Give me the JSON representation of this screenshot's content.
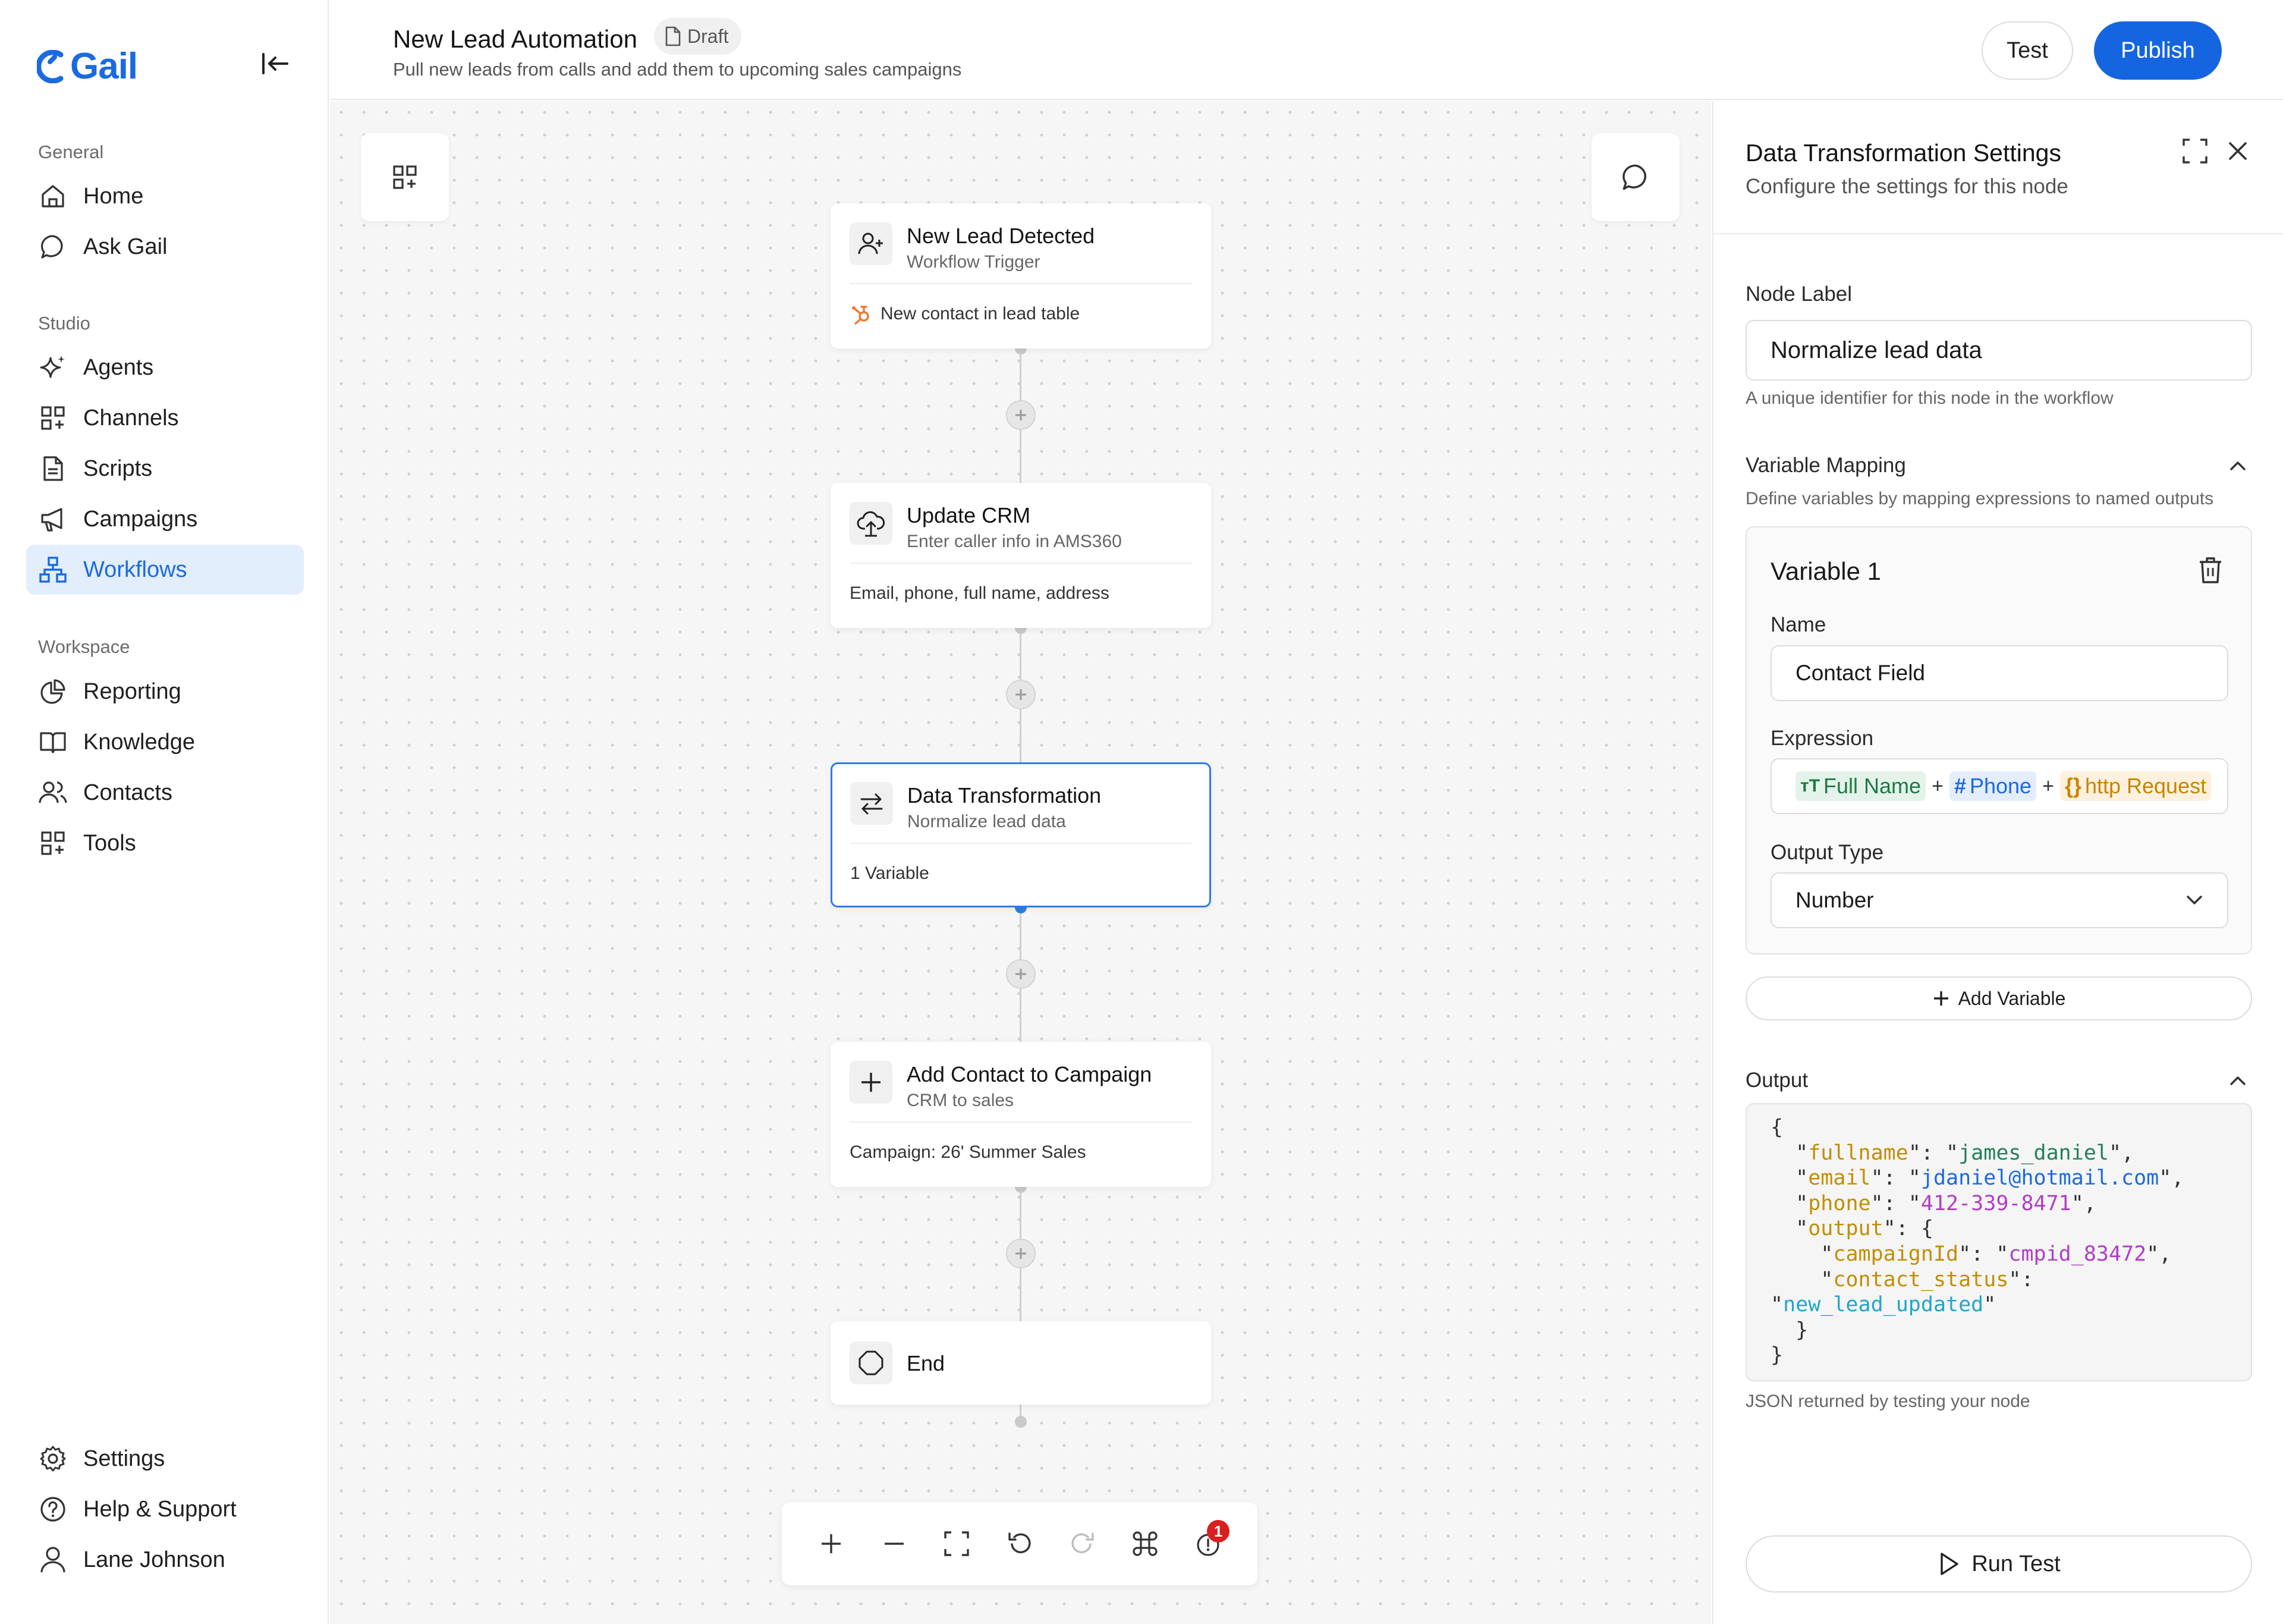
{
  "app": {
    "logo_text": "Gail",
    "brand_color": "#1b6ae0"
  },
  "sidebar": {
    "sections": [
      {
        "label": "General"
      },
      {
        "label": "Studio"
      },
      {
        "label": "Workspace"
      }
    ],
    "items": [
      {
        "label": "Home",
        "icon": "home-icon"
      },
      {
        "label": "Ask Gail",
        "icon": "chat-bubble-icon"
      },
      {
        "label": "Agents",
        "icon": "sparkle-icon"
      },
      {
        "label": "Channels",
        "icon": "grid-plus-icon"
      },
      {
        "label": "Scripts",
        "icon": "document-icon"
      },
      {
        "label": "Campaigns",
        "icon": "megaphone-icon"
      },
      {
        "label": "Workflows",
        "icon": "workflow-icon",
        "active": true
      },
      {
        "label": "Reporting",
        "icon": "pie-chart-icon"
      },
      {
        "label": "Knowledge",
        "icon": "book-icon"
      },
      {
        "label": "Contacts",
        "icon": "users-icon"
      },
      {
        "label": "Tools",
        "icon": "grid-plus-icon"
      }
    ],
    "bottom_items": [
      {
        "label": "Settings",
        "icon": "gear-icon"
      },
      {
        "label": "Help & Support",
        "icon": "help-circle-icon"
      },
      {
        "label": "Lane Johnson",
        "icon": "user-icon"
      }
    ]
  },
  "header": {
    "title": "New Lead Automation",
    "badge": "Draft",
    "subtitle": "Pull new leads from calls and add them to upcoming sales campaigns",
    "test_label": "Test",
    "publish_label": "Publish"
  },
  "workflow": {
    "nodes": [
      {
        "title": "New Lead Detected",
        "subtitle": "Workflow Trigger",
        "footer": "New contact in lead table",
        "icon": "user-plus-icon",
        "footer_icon": "hubspot-icon"
      },
      {
        "title": "Update CRM",
        "subtitle": "Enter caller info in AMS360",
        "footer": "Email, phone, full name, address",
        "icon": "cloud-upload-icon"
      },
      {
        "title": "Data Transformation",
        "subtitle": "Normalize lead data",
        "footer": "1 Variable",
        "icon": "swap-arrows-icon",
        "selected": true
      },
      {
        "title": "Add Contact to Campaign",
        "subtitle": "CRM to sales",
        "footer": "Campaign: 26' Summer Sales",
        "icon": "plus-icon"
      },
      {
        "title": "End",
        "icon": "octagon-icon"
      }
    ],
    "zoom_controls": [
      "zoom-in-icon",
      "zoom-out-icon",
      "fit-view-icon",
      "undo-icon",
      "redo-icon",
      "command-icon",
      "alert-icon"
    ],
    "alert_count": "1"
  },
  "panel": {
    "title": "Data Transformation Settings",
    "subtitle": "Configure the settings for this node",
    "node_label": {
      "label": "Node Label",
      "value": "Normalize lead data",
      "help": "A unique identifier for this node in the workflow"
    },
    "variable_mapping": {
      "title": "Variable Mapping",
      "description": "Define variables by mapping expressions to named outputs",
      "variables": [
        {
          "title": "Variable 1",
          "name_label": "Name",
          "name_value": "Contact Field",
          "expression_label": "Expression",
          "expression_chips": [
            {
              "label": "Full Name",
              "icon": "text-type-icon"
            },
            {
              "label": "Phone",
              "icon": "hash-icon"
            },
            {
              "label": "http Request",
              "icon": "braces-icon"
            }
          ],
          "operator": "+",
          "output_type_label": "Output Type",
          "output_type_value": "Number"
        }
      ],
      "add_label": "Add Variable"
    },
    "output": {
      "title": "Output",
      "lines": [
        {
          "indent": "",
          "key": "",
          "val": "",
          "raw": "{"
        },
        {
          "indent": "  ",
          "key": "fullname",
          "val": "james_daniel",
          "trail": ","
        },
        {
          "indent": "  ",
          "key": "email",
          "val": "jdaniel@hotmail.com",
          "trail": ","
        },
        {
          "indent": "  ",
          "key": "phone",
          "val": "412-339-8471",
          "trail": ","
        },
        {
          "indent": "  ",
          "key": "output",
          "raw_after": ": {"
        },
        {
          "indent": "    ",
          "key": "campaignId",
          "val": "cmpid_83472",
          "trail": ","
        },
        {
          "indent": "    ",
          "key": "contact_status",
          "raw_after": ":"
        },
        {
          "indent": "",
          "val_only": "new_lead_updated"
        },
        {
          "indent": "  ",
          "raw": "}"
        },
        {
          "indent": "",
          "raw": "}"
        }
      ],
      "help": "JSON returned by testing your node"
    },
    "run_test_label": "Run Test"
  }
}
